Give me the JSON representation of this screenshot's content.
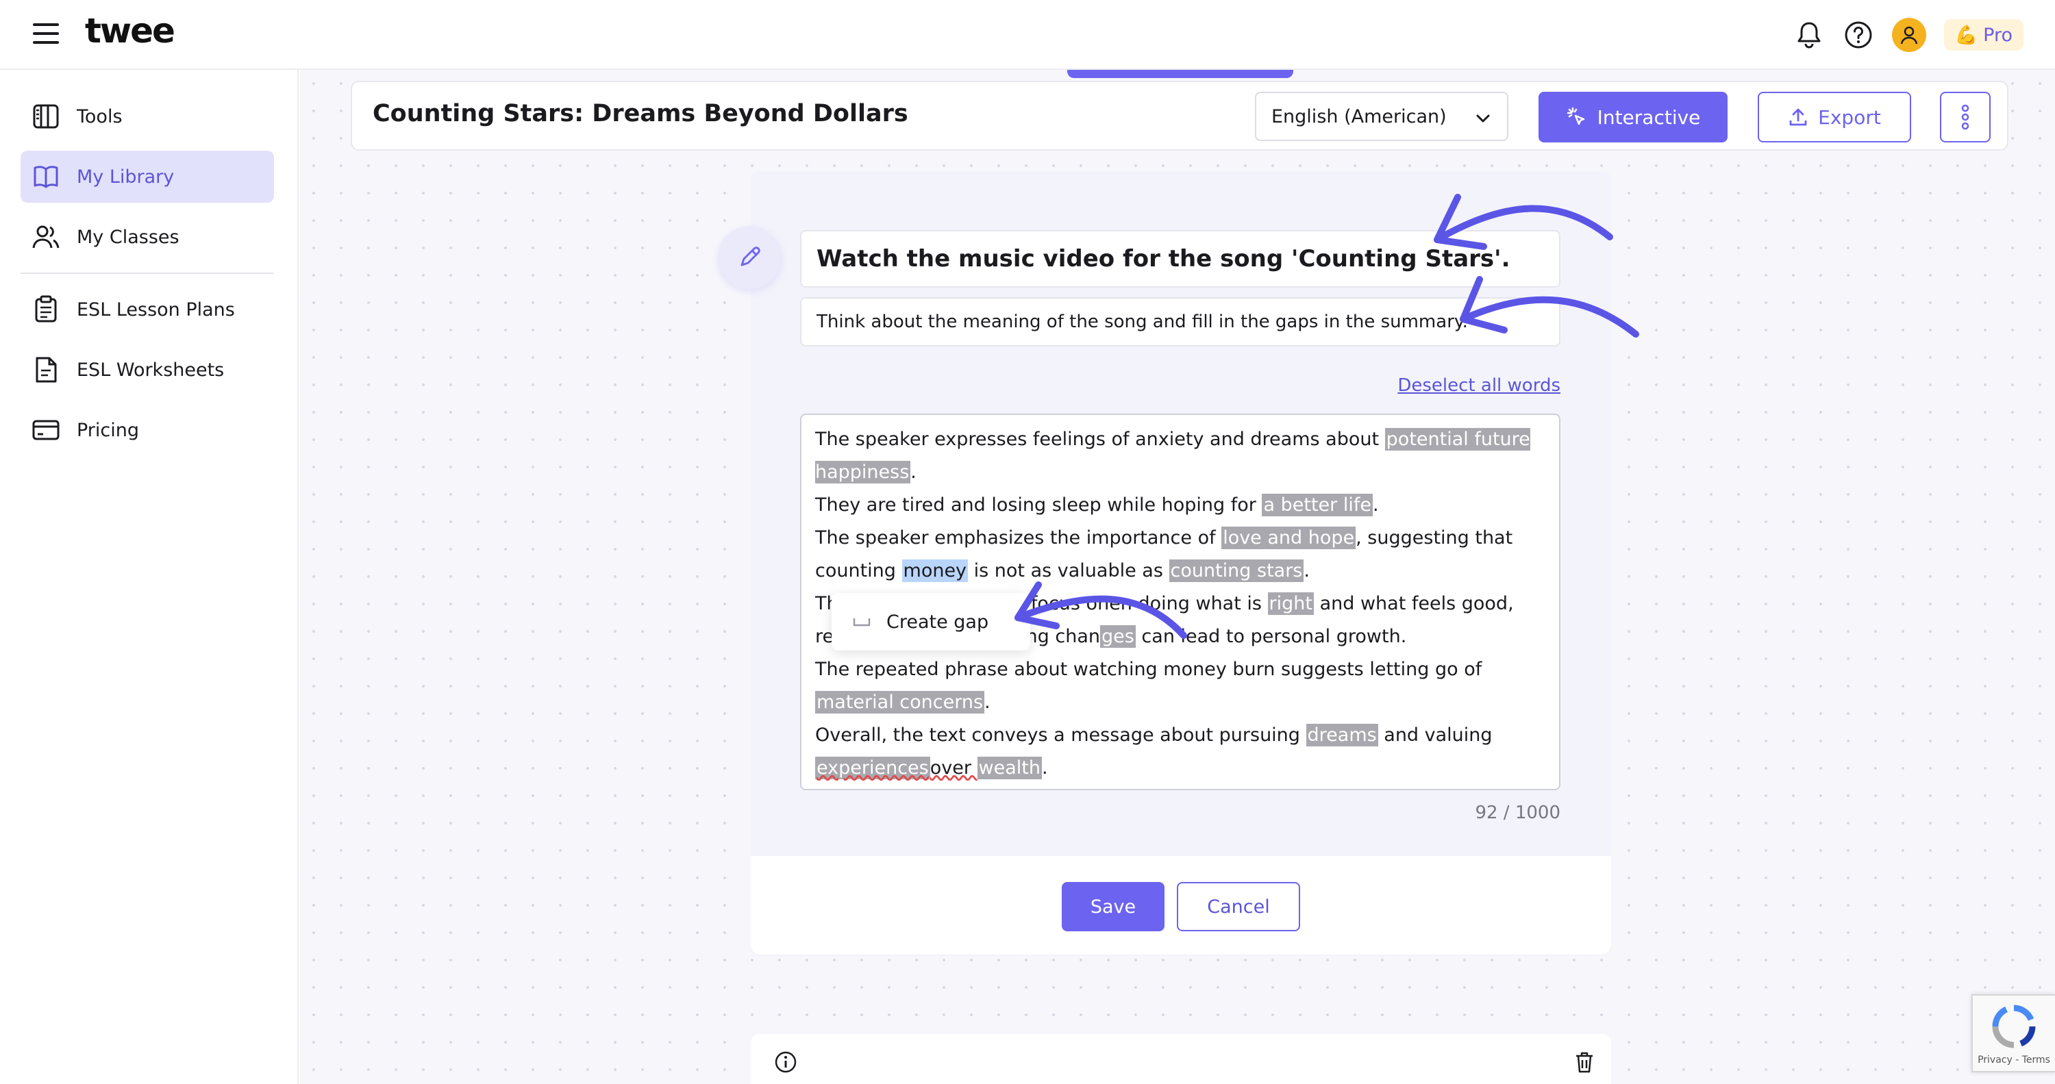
{
  "header": {
    "logo": "twee",
    "plan_badge": "Pro",
    "plan_emoji": "💪"
  },
  "sidebar": {
    "items": [
      {
        "label": "Tools",
        "icon": "tools-icon"
      },
      {
        "label": "My Library",
        "icon": "library-icon",
        "active": true
      },
      {
        "label": "My Classes",
        "icon": "classes-icon"
      },
      {
        "label": "ESL Lesson Plans",
        "icon": "lesson-plans-icon"
      },
      {
        "label": "ESL Worksheets",
        "icon": "worksheets-icon"
      },
      {
        "label": "Pricing",
        "icon": "pricing-icon"
      }
    ]
  },
  "toolbar": {
    "doc_title": "Counting Stars: Dreams Beyond Dollars",
    "language": "English (American)",
    "interactive_label": "Interactive",
    "export_label": "Export"
  },
  "exercise": {
    "title": "Watch the music video for the song 'Counting Stars'.",
    "subtitle": "Think about the meaning of the song and fill in the gaps in the summary.",
    "deselect_label": "Deselect all words",
    "char_count": "92 / 1000",
    "popup_label": "Create gap",
    "text": {
      "l1a": "The speaker expresses feelings of anxiety and dreams about ",
      "g1": "potential future happiness",
      "l1b": ".",
      "l2a": "They are tired and losing sleep while hoping for ",
      "g2": "a better life",
      "l2b": ".",
      "l3a": "The speaker emphasizes the importance of ",
      "g3": "love and hope",
      "l3b": ", suggesting that counting ",
      "sel": "money",
      "l3c": " is not as valuable as ",
      "g4": "counting stars",
      "l3d": ".",
      "l4a": "Th",
      "l4hidden": "e text highlights the focus on",
      "l4b": "en doing what is ",
      "g5": "right",
      "l4c": " and what feels good,",
      "l5a": "re",
      "l5hidden": "vealing that embracing chan",
      "g6": "ges",
      "l5b": " can lead to personal growth.",
      "l6a": "The repeated phrase about watching money burn suggests letting go of ",
      "g7": "material concerns",
      "l6b": ".",
      "l7a": "Overall, the text conveys a message about pursuing ",
      "g8": "dreams",
      "l7b": " and valuing",
      "g9": "experiences",
      "l7c": "over ",
      "g10": "wealth",
      "l7d": "."
    }
  },
  "actions": {
    "save_label": "Save",
    "cancel_label": "Cancel"
  },
  "recaptcha": {
    "footer": "Privacy - Terms"
  },
  "colors": {
    "accent": "#6c63f0",
    "gap_bg": "#a8a8ae",
    "selection_bg": "#bad5fb",
    "active_nav_bg": "#e2e1fb"
  }
}
